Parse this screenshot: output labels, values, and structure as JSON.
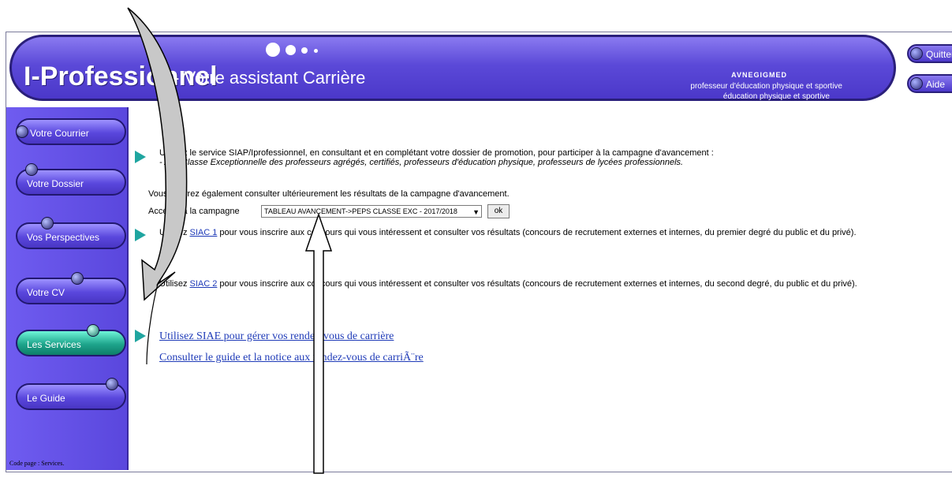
{
  "header": {
    "app_title": "I-Professionnel",
    "app_subtitle": "- Votre assistant Carrière",
    "user_name": "AVNEGIGMED",
    "user_role": "professeur d'éducation physique et sportive",
    "user_dept": "éducation physique et sportive",
    "quit_label": "Quitter",
    "help_label": "Aide"
  },
  "sidebar": {
    "items": [
      {
        "label": "Votre Courrier"
      },
      {
        "label": "Votre Dossier"
      },
      {
        "label": "Vos Perspectives"
      },
      {
        "label": "Votre CV"
      },
      {
        "label": "Les Services"
      },
      {
        "label": "Le Guide"
      }
    ],
    "code_page": "Code page : Services."
  },
  "content": {
    "siap_line1": "Utilisez le service SIAP/Iprofessionnel, en consultant et en complétant votre dossier de promotion, pour participer à la campagne d'avancement :",
    "siap_line2": "- A la Classe Exceptionnelle des professeurs agrégés, certifiés, professeurs d'éducation physique, professeurs de lycées professionnels.",
    "results_line": "Vous pourrez également consulter ultérieurement les résultats de la campagne d'avancement.",
    "access_label": "Accéder à la campagne",
    "campaign_selected": "TABLEAU AVANCEMENT->PEPS CLASSE EXC - 2017/2018",
    "ok_label": "ok",
    "siac1_prefix": "Utilisez ",
    "siac1_link": "SIAC 1",
    "siac1_suffix": " pour vous inscrire aux concours qui vous intéressent et consulter vos résultats (concours de recrutement externes et internes, du premier degré du public et du privé).",
    "siac2_prefix": "Utilisez ",
    "siac2_link": "SIAC 2",
    "siac2_suffix": " pour vous inscrire aux concours qui vous intéressent et consulter vos résultats (concours de recrutement externes et internes, du second degré, du public et du privé).",
    "siae_link": "Utilisez SIAE pour gérer vos rendez-vous de carrière",
    "guide_link": "Consulter le guide et la notice aux rendez-vous de carriÃ¨re"
  },
  "colors": {
    "header_purple": "#5b49d8",
    "active_teal": "#1ea58c",
    "link_blue": "#1f3bb8",
    "bullet_teal": "#1fa5a0"
  }
}
